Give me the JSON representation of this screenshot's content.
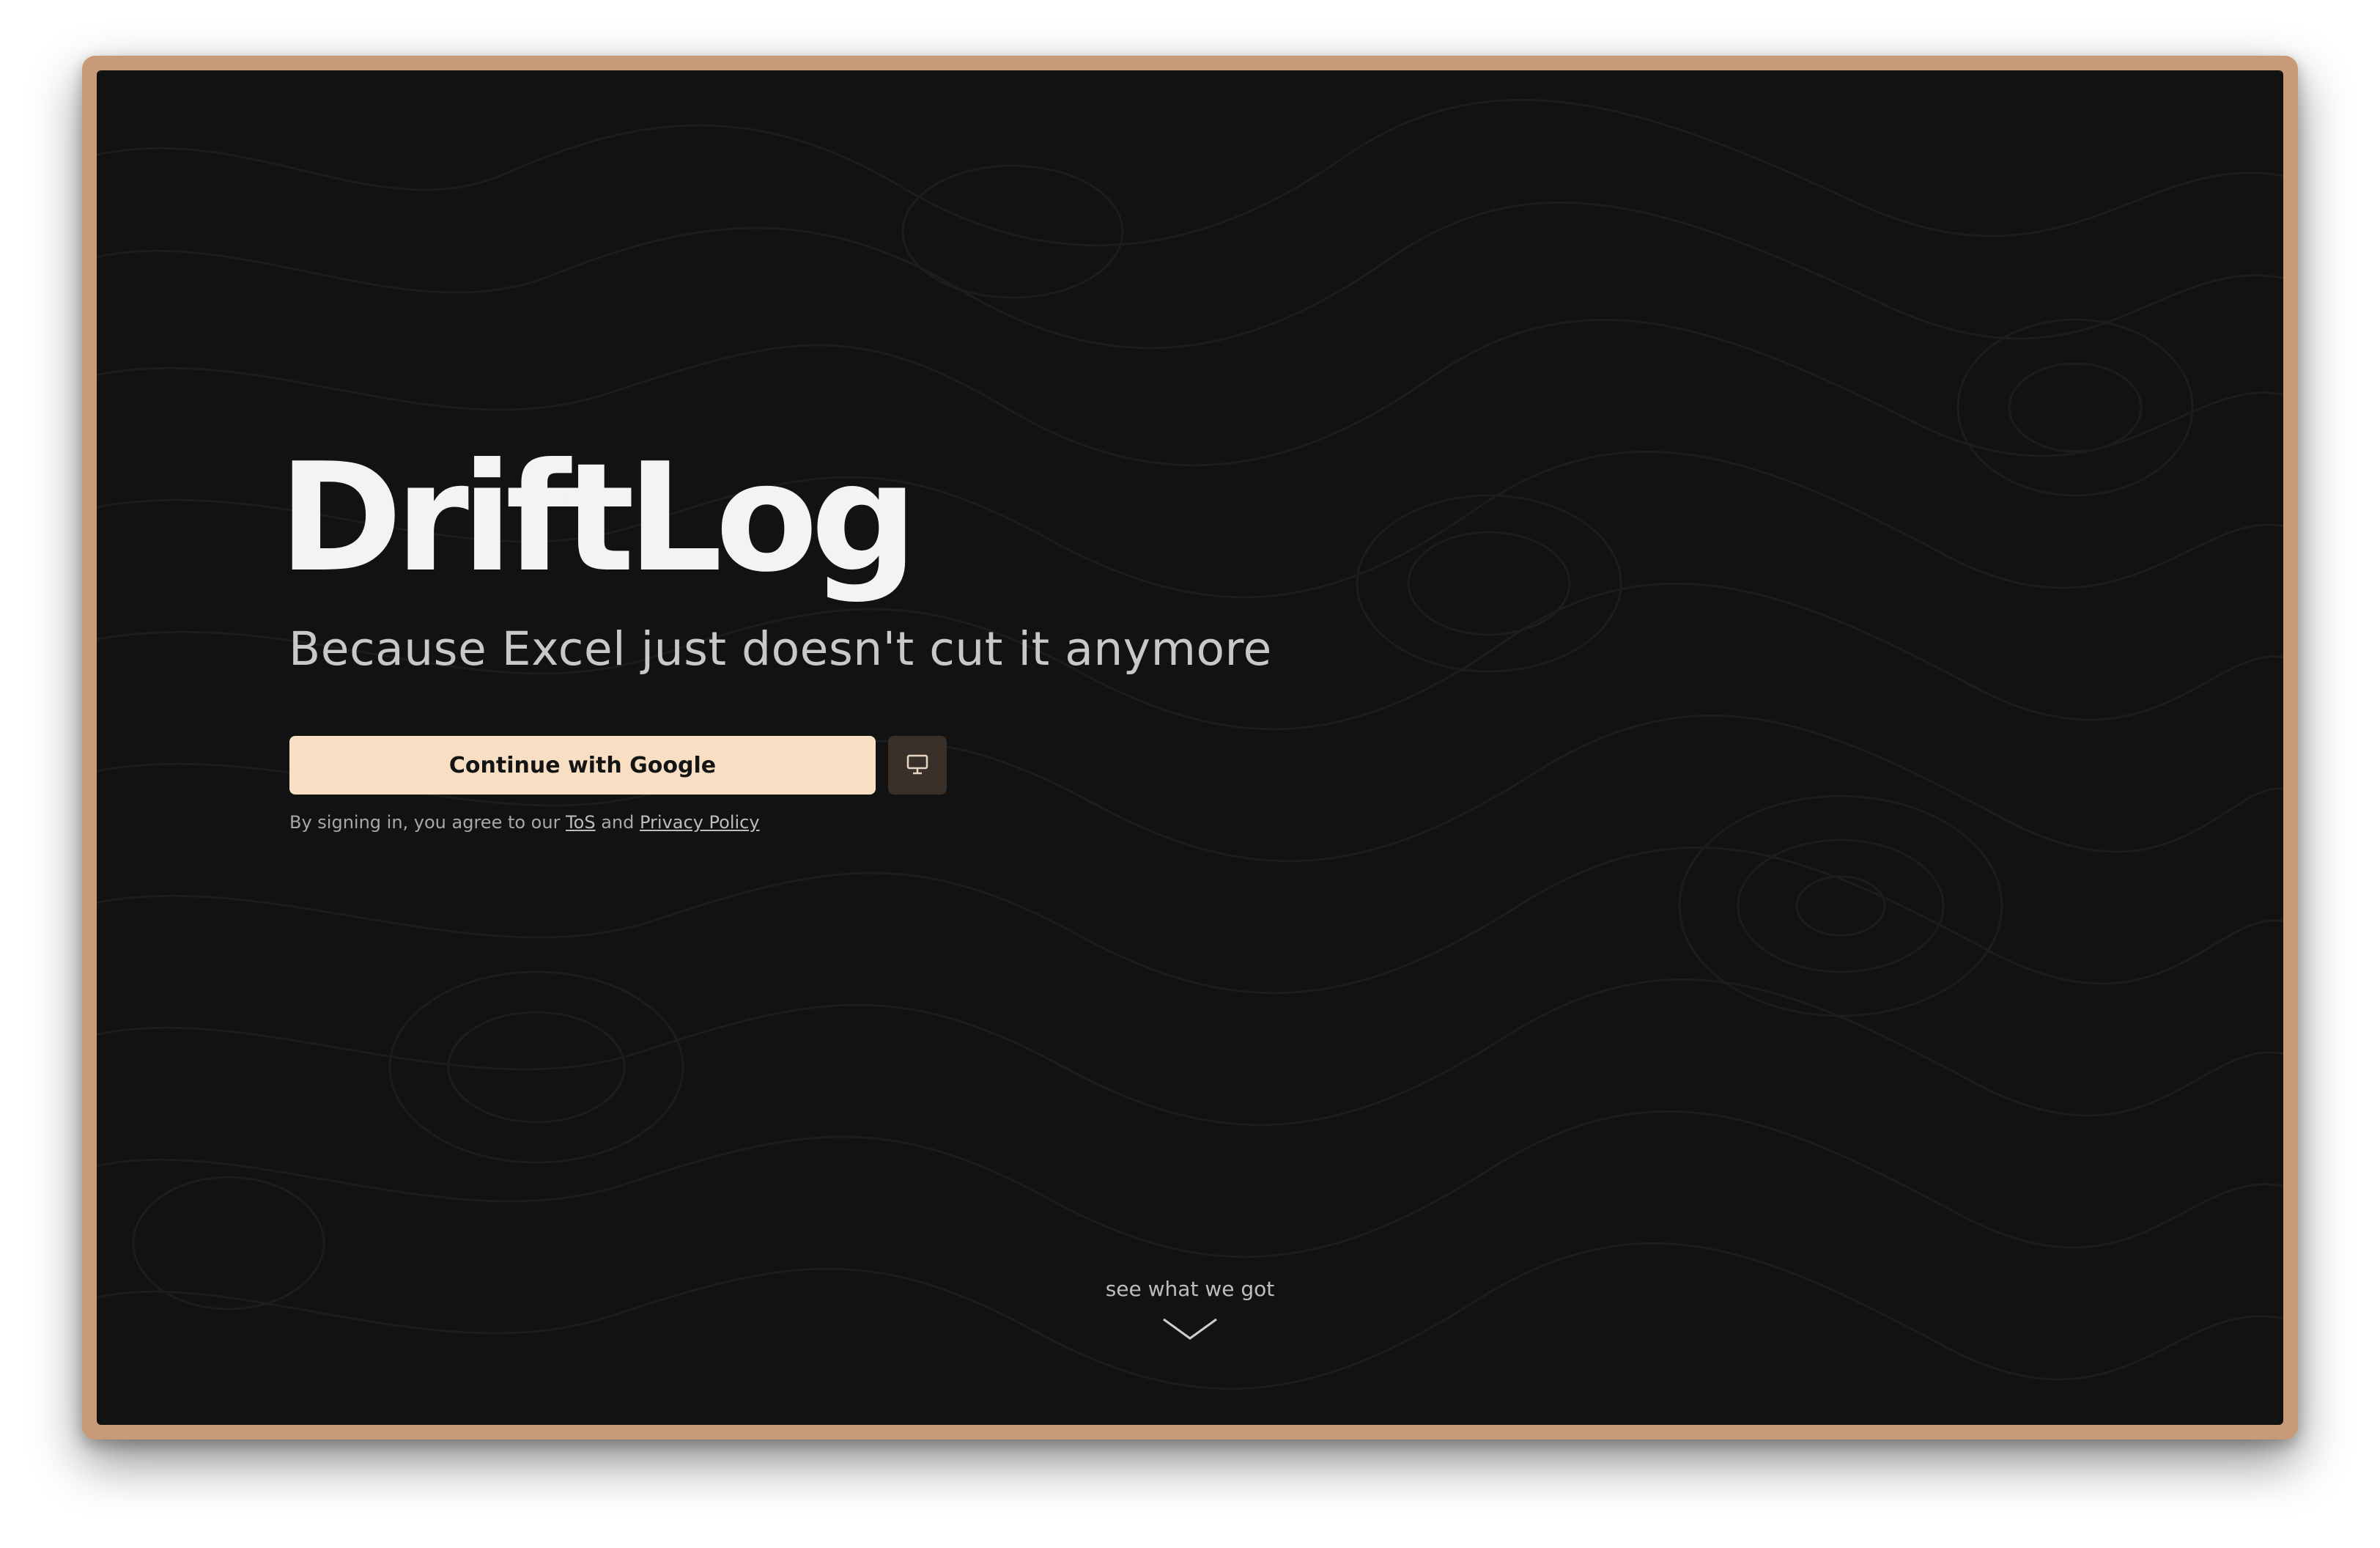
{
  "app": {
    "title": "DriftLog",
    "tagline": "Because Excel just doesn't cut it anymore"
  },
  "auth": {
    "google_button_label": "Continue with Google",
    "device_button_icon": "monitor-icon",
    "legal_prefix": "By signing in, you agree to our ",
    "tos_link": "ToS",
    "legal_and": " and ",
    "privacy_link": "Privacy Policy"
  },
  "scroll_hint": {
    "label": "see what we got",
    "icon": "chevron-down-icon"
  },
  "colors": {
    "background": "#121212",
    "frame": "#c99a78",
    "primary_button": "#f8dfc3",
    "secondary_button": "#3a302a",
    "heading": "#f3f3f3",
    "muted_text": "#c8c8c8"
  }
}
